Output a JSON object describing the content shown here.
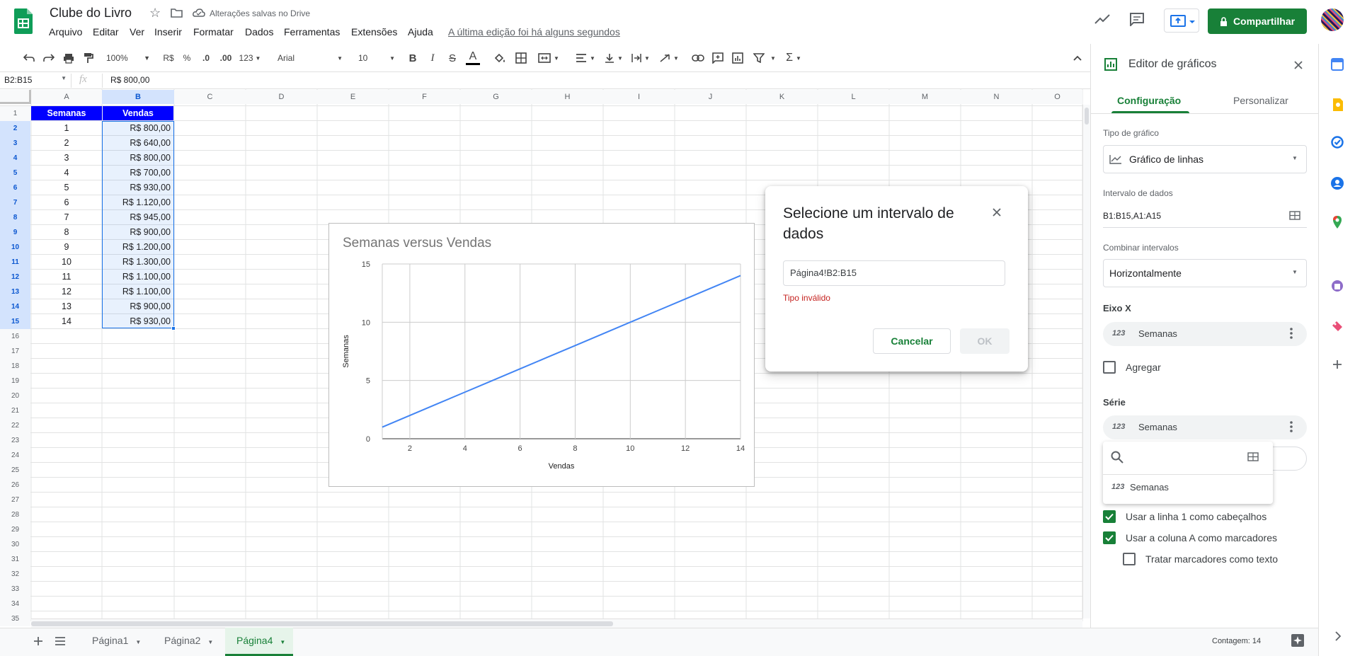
{
  "header": {
    "doc_title": "Clube do Livro",
    "save_status": "Alterações salvas no Drive",
    "menu": [
      "Arquivo",
      "Editar",
      "Ver",
      "Inserir",
      "Formatar",
      "Dados",
      "Ferramentas",
      "Extensões",
      "Ajuda"
    ],
    "last_edit": "A última edição foi há alguns segundos",
    "share_label": "Compartilhar"
  },
  "toolbar": {
    "zoom": "100%",
    "currency": "R$",
    "percent": "%",
    "dec_decrease": ".0",
    "dec_increase": ".00",
    "more_formats": "123",
    "font": "Arial",
    "font_size": "10",
    "bold": "B",
    "italic": "I",
    "strike": "S",
    "text_color": "A",
    "sigma": "Σ"
  },
  "formula_bar": {
    "name_box": "B2:B15",
    "fx": "fx",
    "value": "R$ 800,00"
  },
  "columns": [
    "A",
    "B",
    "C",
    "D",
    "E",
    "F",
    "G",
    "H",
    "I",
    "J",
    "K",
    "L",
    "M",
    "N",
    "O"
  ],
  "rows": [
    "1",
    "2",
    "3",
    "4",
    "5",
    "6",
    "7",
    "8",
    "9",
    "10",
    "11",
    "12",
    "13",
    "14",
    "15",
    "16",
    "17",
    "18",
    "19",
    "20",
    "21",
    "22",
    "23",
    "24",
    "25",
    "26",
    "27",
    "28",
    "29",
    "30",
    "31",
    "32",
    "33",
    "34",
    "35"
  ],
  "table": {
    "headers": [
      "Semanas",
      "Vendas"
    ],
    "weeks": [
      "1",
      "2",
      "3",
      "4",
      "5",
      "6",
      "7",
      "8",
      "9",
      "10",
      "11",
      "12",
      "13",
      "14"
    ],
    "sales": [
      "R$ 800,00",
      "R$ 640,00",
      "R$ 800,00",
      "R$ 700,00",
      "R$ 930,00",
      "R$ 1.120,00",
      "R$ 945,00",
      "R$ 900,00",
      "R$ 1.200,00",
      "R$ 1.300,00",
      "R$ 1.100,00",
      "R$ 1.100,00",
      "R$ 900,00",
      "R$ 930,00"
    ]
  },
  "chart_data": {
    "type": "line",
    "title": "Semanas versus Vendas",
    "xlabel": "Vendas",
    "ylabel": "Semanas",
    "x": [
      1,
      2,
      3,
      4,
      5,
      6,
      7,
      8,
      9,
      10,
      11,
      12,
      13,
      14
    ],
    "series": [
      {
        "values": [
          1,
          2,
          3,
          4,
          5,
          6,
          7,
          8,
          9,
          10,
          11,
          12,
          13,
          14
        ],
        "color": "#4285f4"
      }
    ],
    "xlim": [
      1,
      14
    ],
    "ylim": [
      0,
      15
    ],
    "xticks": [
      "2",
      "4",
      "6",
      "8",
      "10",
      "12",
      "14"
    ],
    "yticks": [
      "0",
      "5",
      "10",
      "15"
    ],
    "grid": true
  },
  "dialog": {
    "title": "Selecione um intervalo de dados",
    "input_value": "Página4!B2:B15",
    "error": "Tipo inválido",
    "cancel": "Cancelar",
    "ok": "OK"
  },
  "chart_editor": {
    "title": "Editor de gráficos",
    "tabs": [
      "Configuração",
      "Personalizar"
    ],
    "chart_type_label": "Tipo de gráfico",
    "chart_type_value": "Gráfico de linhas",
    "data_range_label": "Intervalo de dados",
    "data_range_value": "B1:B15,A1:A15",
    "combine_label": "Combinar intervalos",
    "combine_value": "Horizontalmente",
    "x_axis_label": "Eixo X",
    "x_axis_value": "Semanas",
    "aggregate_label": "Agregar",
    "series_label": "Série",
    "series_value": "Semanas",
    "series_dropdown_item": "Semanas",
    "type_icon": "123",
    "use_row1": "Usar a linha 1 como cabeçalhos",
    "use_colA": "Usar a coluna A como marcadores",
    "treat_text": "Tratar marcadores como texto"
  },
  "sheets": {
    "tabs": [
      "Página1",
      "Página2",
      "Página4"
    ],
    "active": "Página4",
    "count": "Contagem: 14"
  },
  "colors": {
    "accent": "#188038",
    "header_fill": "#0000ff",
    "selection": "#1a73e8",
    "error": "#c5221f"
  }
}
